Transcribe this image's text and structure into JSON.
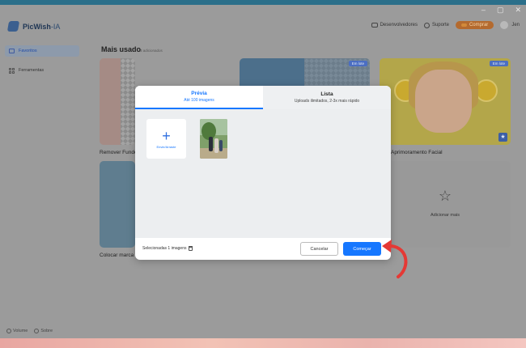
{
  "window": {
    "controls": [
      "–",
      "▢",
      "✕"
    ]
  },
  "header": {
    "app_name": "PicWish",
    "app_suffix": "-IA",
    "developers": "Desenvolvedores",
    "support": "Suporte",
    "buy": "Comprar",
    "user": "Jen"
  },
  "sidebar": {
    "items": [
      {
        "label": "Favoritos",
        "icon": "star-icon"
      },
      {
        "label": "Ferramentas",
        "icon": "grid-icon"
      }
    ],
    "footer_volume": "Volume",
    "footer_about": "Sobre"
  },
  "main": {
    "section_title": "Mais usado",
    "section_count": "3 adicionados",
    "cards": [
      {
        "badge": "Em lote",
        "label": "Remover Fundo"
      },
      {
        "badge": "Em lote",
        "label": ""
      },
      {
        "badge": "Em lote",
        "label": "Aprimoramento Facial"
      },
      {
        "badge": "",
        "label": "Colocar marca"
      },
      {
        "badge": "",
        "label": "Adicionar mais"
      }
    ]
  },
  "modal": {
    "tabs": [
      {
        "title": "Prévia",
        "subtitle": "Até 100 imagens"
      },
      {
        "title": "Lista",
        "subtitle": "Uploads ilimitados, 2-3x mais rápido"
      }
    ],
    "add_tile_label": "Envie/Arraste",
    "selected_text": "Selecionadas 1 imagens",
    "cancel": "Cancelar",
    "start": "Começar"
  },
  "colors": {
    "accent": "#1677ff",
    "arrow": "#e53935",
    "badge": "#4b6ec2"
  }
}
